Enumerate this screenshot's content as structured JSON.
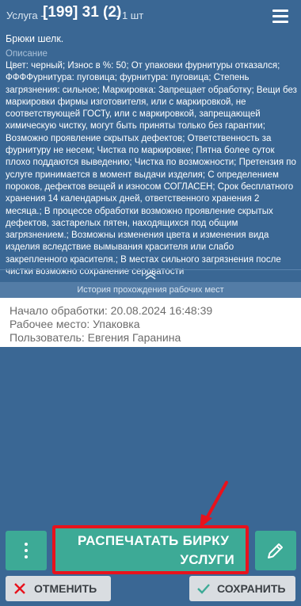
{
  "header": {
    "prefix": "Услуга -",
    "code": "[199] 31 (2)",
    "qty": "- 1 шт",
    "menu_icon": "hamburger-menu-icon"
  },
  "item": {
    "title": "Брюки шелк.",
    "description_label": "Описание",
    "description_text": "Цвет: черный; Износ в %: 50; От упаковки фурнитуры отказался; ФФФФурнитура: пуговица; фурнитура: пуговица; Степень загрязнения: сильное; Маркировка: Запрещает обработку; Вещи без маркировки фирмы изготовителя, или с маркировкой, не соответствующей ГОСТу, или с маркировкой, запрещающей химическую чистку, могут быть приняты только без гарантии; Возможно проявление скрытых дефектов; Ответственность за фурнитуру не несем; Чистка по маркировке; Пятна более суток плохо поддаются выведению; Чистка по возможности; Претензия по услуге принимается в момент выдачи изделия; С определением пороков, дефектов вещей и износом СОГЛАСЕН; Срок бесплатного хранения 14 календарных дней, ответственного хранения 2 месяца.; В процессе обработки возможно проявление скрытых дефектов, застарелых пятен, находящихся под общим загрязнением.; Возможны изменения цвета и изменения вида изделия вследствие вымывания красителя или слабо закрепленного красителя.; В местах сильного загрязнения после чистки возможно сохранение сероватости"
  },
  "history": {
    "title": "История прохождения рабочих мест",
    "start": "Начало обработки: 20.08.2024 16:48:39",
    "workplace": "Рабочее место: Упаковка",
    "user": "Пользователь: Евгения Гаранина"
  },
  "actions": {
    "print_line1": "РАСПЕЧАТАТЬ БИРКУ",
    "print_line2": "УСЛУГИ",
    "cancel": "ОТМЕНИТЬ",
    "save": "СОХРАНИТЬ"
  },
  "colors": {
    "background": "#3a6794",
    "accent": "#3daa96",
    "highlight": "#e8121c",
    "cancel_icon": "#e8121c",
    "save_icon": "#3daa96"
  }
}
